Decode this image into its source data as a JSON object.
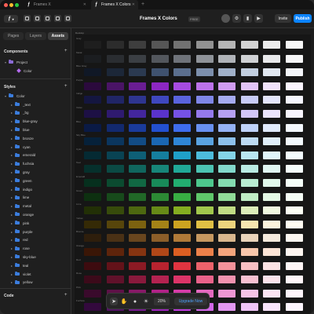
{
  "titlebar": {
    "tabs": [
      {
        "label": "Frames X",
        "active": false
      },
      {
        "label": "Frames X Colors",
        "active": true
      }
    ]
  },
  "toolbar": {
    "doc_title": "Frames X Colors",
    "plan_badge": "FREE",
    "invite_label": "Invite",
    "publish_label": "Publish",
    "accent_color": "#0a84ff"
  },
  "sidebar": {
    "tabs": [
      "Pages",
      "Layers",
      "Assets"
    ],
    "active_tab": "Assets",
    "components": {
      "heading": "Components",
      "items": [
        {
          "label": "Project",
          "icon": "folder-icon"
        },
        {
          "label": "Color",
          "icon": "component-icon"
        }
      ]
    },
    "styles": {
      "heading": "Styles",
      "root": "Color",
      "items": [
        "_text",
        "_bg",
        "blue-gray",
        "blue",
        "bronze",
        "cyan",
        "emerald",
        "fuchsia",
        "gray",
        "green",
        "indigo",
        "lime",
        "metal",
        "orange",
        "pink",
        "purple",
        "red",
        "rose",
        "sky-blue",
        "teal",
        "violet",
        "yellow"
      ]
    },
    "code": {
      "heading": "Code"
    }
  },
  "canvas": {
    "frame_label": "Desktop",
    "row_labels": [
      "Gray",
      "Metal",
      "Blue Gray",
      "Purple",
      "Indigo",
      "Violet",
      "Blue",
      "Sky Blue",
      "Cyan",
      "Teal",
      "Emerald",
      "Green",
      "Lime",
      "Yellow",
      "Bronze",
      "Orange",
      "Red",
      "Rose",
      "Pink",
      "Fuchsia"
    ],
    "palettes": [
      [
        "#1e1e1e",
        "#2c2c2c",
        "#3e3e3e",
        "#565656",
        "#727272",
        "#929292",
        "#b4b4b4",
        "#d2d2d2",
        "#ebebeb",
        "#f7f7f7"
      ],
      [
        "#1b1d20",
        "#2a2d31",
        "#3b3f44",
        "#53575d",
        "#6f737a",
        "#8f9399",
        "#b0b3b8",
        "#cfd1d4",
        "#e8e9eb",
        "#f6f6f7"
      ],
      [
        "#101826",
        "#1c2738",
        "#2b3a51",
        "#3f526f",
        "#5b6f8e",
        "#7c8fac",
        "#a0b0c8",
        "#c2cedf",
        "#e0e6ef",
        "#f3f5f9"
      ],
      [
        "#2b0a3d",
        "#4a1466",
        "#6a1d93",
        "#8c27c2",
        "#a64be0",
        "#bc72ea",
        "#d09cf1",
        "#e2c3f7",
        "#f1e2fb",
        "#faf4fe"
      ],
      [
        "#141640",
        "#202566",
        "#2e3590",
        "#3f47bf",
        "#5a63de",
        "#7f86e7",
        "#a5aaef",
        "#c8cbf6",
        "#e4e5fb",
        "#f5f5fe"
      ],
      [
        "#1d1045",
        "#2f1a70",
        "#43269d",
        "#5a33cc",
        "#7552e6",
        "#9579ec",
        "#b6a0f2",
        "#d3c6f7",
        "#ebe4fc",
        "#f8f5fe"
      ],
      [
        "#0a1a45",
        "#12296e",
        "#1a3b9c",
        "#2350cf",
        "#3e6cec",
        "#6890f0",
        "#94b2f5",
        "#bfd2f9",
        "#e0eafc",
        "#f3f7fe"
      ],
      [
        "#06213a",
        "#0b365e",
        "#124c85",
        "#1a67b3",
        "#2f86d6",
        "#5aa3e0",
        "#8cc0ea",
        "#bddbf3",
        "#e0effa",
        "#f3f9fd"
      ],
      [
        "#052a33",
        "#094353",
        "#0e5f76",
        "#157e9e",
        "#1fa0c8",
        "#4dbcdc",
        "#84d3e7",
        "#b9e6f1",
        "#e0f4f9",
        "#f4fbfd"
      ],
      [
        "#06302c",
        "#0b4a44",
        "#10665e",
        "#178679",
        "#20a897",
        "#4cc3b2",
        "#83d8cb",
        "#b9eae2",
        "#e0f6f2",
        "#f4fcfb"
      ],
      [
        "#06301e",
        "#0b4b30",
        "#116843",
        "#188a59",
        "#22ad70",
        "#4dc78d",
        "#84dbb0",
        "#b9edd2",
        "#e0f8eb",
        "#f4fdf8"
      ],
      [
        "#0d3010",
        "#174a1b",
        "#216827",
        "#2c8a34",
        "#38ad43",
        "#5fc76a",
        "#90db98",
        "#c0edc5",
        "#e3f8e5",
        "#f5fdf6"
      ],
      [
        "#223006",
        "#374b0b",
        "#4d6810",
        "#678a17",
        "#84ad20",
        "#a1c74c",
        "#c0db84",
        "#dcedb9",
        "#f0f8e0",
        "#fafdf4"
      ],
      [
        "#352a06",
        "#57450b",
        "#7c6210",
        "#a38217",
        "#cca320",
        "#e0bf44",
        "#ecd37d",
        "#f5e5b0",
        "#fbf3dc",
        "#fefbf2"
      ],
      [
        "#2e1e0c",
        "#4a3115",
        "#69461e",
        "#8c5e29",
        "#b07a38",
        "#c69860",
        "#d9b78e",
        "#e9d4bb",
        "#f5eadd",
        "#fcf7f1"
      ],
      [
        "#3a1606",
        "#5e240b",
        "#853411",
        "#b04718",
        "#dc5e22",
        "#ec804a",
        "#f3a47c",
        "#f8c6ab",
        "#fce4d6",
        "#fef5f0"
      ],
      [
        "#3d0b0f",
        "#631219",
        "#8c1a24",
        "#b8232f",
        "#e03440",
        "#ec626b",
        "#f3929a",
        "#f8bfc3",
        "#fce2e4",
        "#fef5f5"
      ],
      [
        "#3c0a1a",
        "#60112a",
        "#89193c",
        "#b42250",
        "#dc3468",
        "#e9628a",
        "#f192ae",
        "#f7c0d1",
        "#fbe2ea",
        "#fef5f8"
      ],
      [
        "#3a0a2c",
        "#5e1147",
        "#861966",
        "#b02287",
        "#d63ca8",
        "#e469bf",
        "#ee97d3",
        "#f5c3e5",
        "#fbe3f3",
        "#fef5fb"
      ],
      [
        "#33093d",
        "#531165",
        "#771a8f",
        "#9c23bb",
        "#bf3ade",
        "#d267e8",
        "#e297f0",
        "#efc4f6",
        "#f8e3fb",
        "#fdf5fe"
      ]
    ]
  },
  "bottom_toolbar": {
    "zoom": "20%",
    "upgrade_label": "Upgrade Now"
  }
}
